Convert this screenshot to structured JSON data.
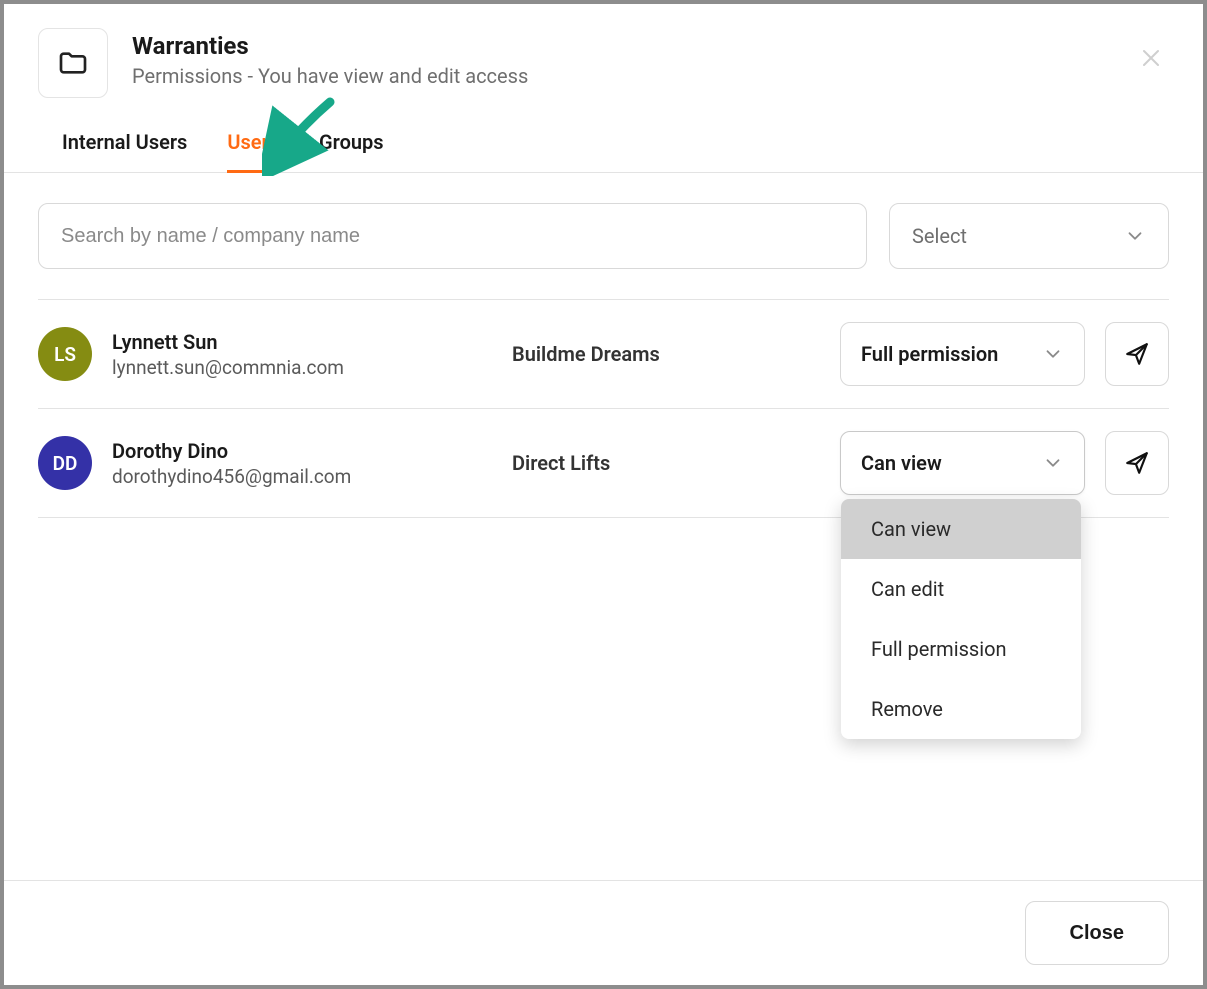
{
  "header": {
    "title": "Warranties",
    "subtitle": "Permissions - You have view and edit access"
  },
  "tabs": [
    {
      "label": "Internal Users",
      "active": false
    },
    {
      "label": "Users",
      "active": true
    },
    {
      "label": "Groups",
      "active": false
    }
  ],
  "search": {
    "placeholder": "Search by name / company name",
    "value": ""
  },
  "filter": {
    "label": "Select"
  },
  "users": [
    {
      "initials": "LS",
      "avatar_color": "#858c12",
      "name": "Lynnett Sun",
      "email": "lynnett.sun@commnia.com",
      "company": "Buildme Dreams",
      "permission": "Full permission",
      "dropdown_open": false
    },
    {
      "initials": "DD",
      "avatar_color": "#3431a7",
      "name": "Dorothy Dino",
      "email": "dorothydino456@gmail.com",
      "company": "Direct Lifts",
      "permission": "Can view",
      "dropdown_open": true
    }
  ],
  "permission_options": [
    "Can view",
    "Can edit",
    "Full permission",
    "Remove"
  ],
  "footer": {
    "close_label": "Close"
  },
  "icons": {
    "folder": "folder-icon",
    "close": "close-icon",
    "chevron": "chevron-down-icon",
    "send": "send-icon"
  },
  "colors": {
    "accent": "#ff6a13",
    "annotation": "#17a889"
  }
}
